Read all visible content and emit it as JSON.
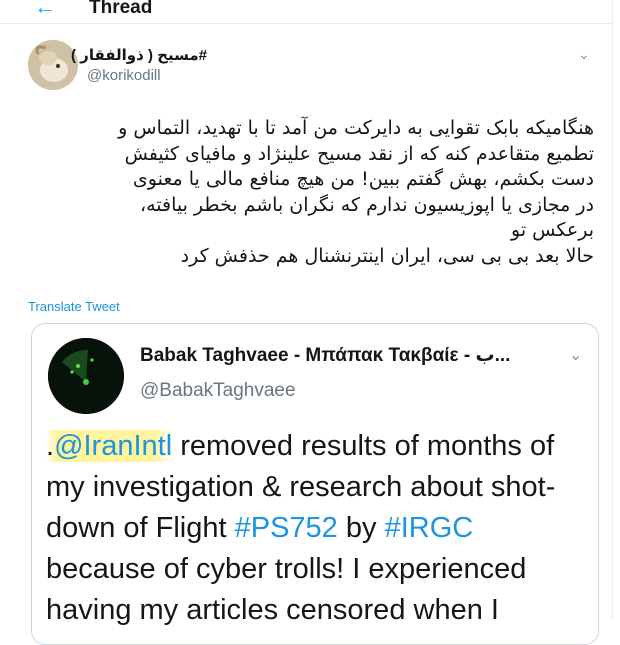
{
  "header": {
    "back_icon": "back-arrow-icon",
    "title": "Thread"
  },
  "tweet": {
    "author_name": "#مسیح ( ذوالفقار )",
    "handle": "@korikodill",
    "menu_icon": "chevron-down-icon",
    "text_lines": [
      "هنگامیکه بابک تقوایی به دایرکت من آمد تا با تهدید، التماس و",
      "تطمیع متقاعدم کنه که از نقد مسیح علینژاد و مافیای کثیفش",
      "دست بکشم، بهش گفتم ببین! من هیچ منافع مالی یا معنوی",
      "در مجازی یا اپوزیسیون ندارم که نگران باشم بخطر بیافته،",
      "برعکس تو",
      "حالا بعد بی بی سی، ایران اینترنشنال هم حذفش کرد"
    ],
    "translate_label": "Translate Tweet"
  },
  "quoted_tweet": {
    "author_name": "Babak Taghvaee - Μπάπακ Τακβαίε - ب...",
    "handle": "@BabakTaghvaee",
    "menu_icon": "chevron-down-icon",
    "text": {
      "prefix": ".",
      "mention": "@IranIntl",
      "part1": " removed results of months of my investigation & research about shot-down of Flight ",
      "hashtag1": "#PS752",
      "part2": " by ",
      "hashtag2": "#IRGC",
      "part3": " because of cyber trolls! I experienced having my articles censored when I"
    }
  },
  "colors": {
    "accent": "#1da1f2",
    "link": "#1b95e0",
    "highlight": "#fff496"
  }
}
